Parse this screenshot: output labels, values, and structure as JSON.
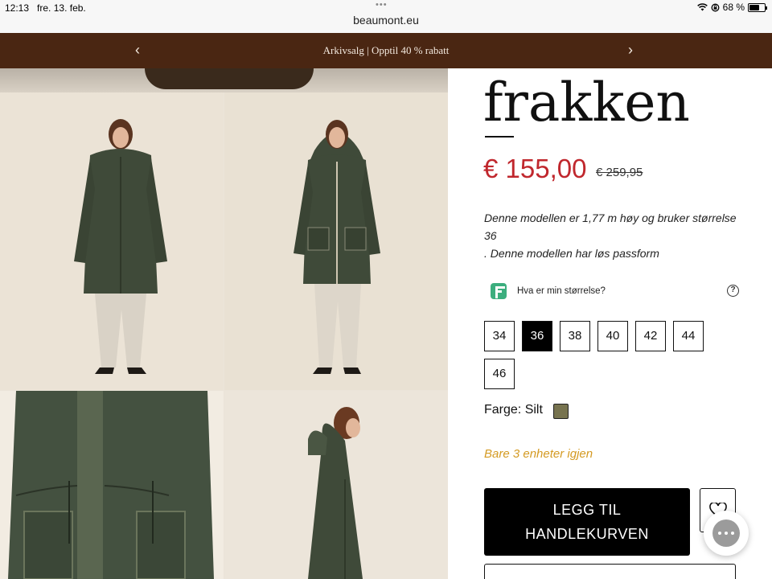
{
  "status_bar": {
    "time": "12:13",
    "date": "fre. 13. feb.",
    "dots": "•••",
    "url": "beaumont.eu",
    "battery_text": "68 %",
    "battery_level": 0.68,
    "icons": [
      "wifi-icon",
      "rotation-lock-icon",
      "battery-icon"
    ]
  },
  "promo": {
    "text": "Arkivsalg | Opptil 40 % rabatt",
    "prev": "‹",
    "next": "›"
  },
  "product": {
    "title": "frakken",
    "price": "€ 155,00",
    "old_price": "€ 259,95",
    "description_1": "Denne modellen er 1,77 m høy og bruker størrelse 36",
    "description_2": ". Denne modellen har løs passform",
    "size_guide_label": "Hva er min størrelse?",
    "size_guide_help": "?",
    "sizes": [
      "34",
      "36",
      "38",
      "40",
      "42",
      "44",
      "46"
    ],
    "selected_size": "36",
    "color_label": "Farge: Silt",
    "color_hex": "#77734f",
    "stock_text": "Bare 3 enheter igjen",
    "add_to_cart_line1": "LEGG TIL",
    "add_to_cart_line2": "HANDLEKURVEN"
  },
  "colors": {
    "promo_bg": "#4a2612",
    "price_red": "#c0272d",
    "stock_amber": "#d49a22",
    "coat_green": "#3f4a39"
  }
}
